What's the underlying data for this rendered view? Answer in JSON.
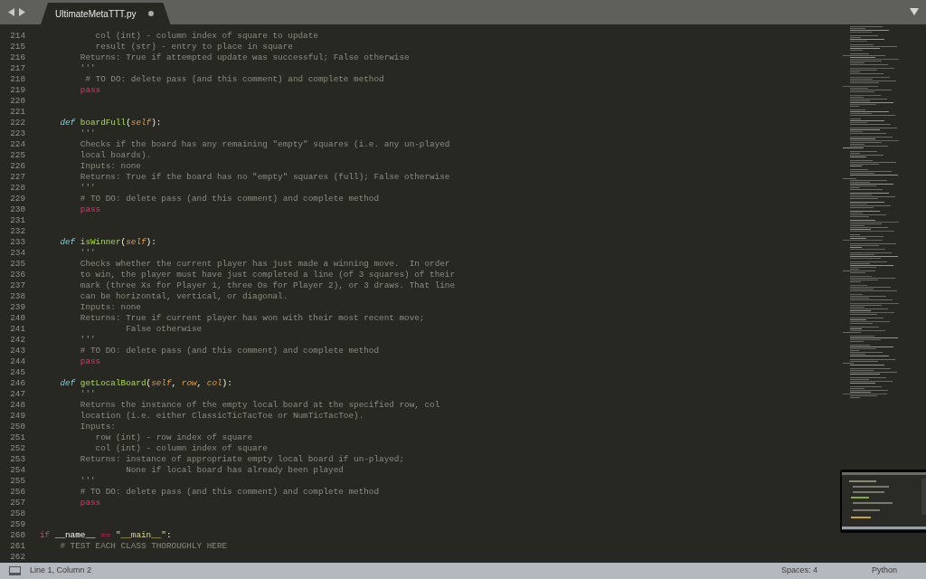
{
  "tab": {
    "title": "UltimateMetaTTT.py",
    "modified": true
  },
  "lines": [
    {
      "number": "214",
      "tokens": [
        {
          "kind": "doc",
          "text": "           col (int) - column index of square to update"
        }
      ]
    },
    {
      "number": "215",
      "tokens": [
        {
          "kind": "doc",
          "text": "           result (str) - entry to place in square"
        }
      ]
    },
    {
      "number": "216",
      "tokens": [
        {
          "kind": "doc",
          "text": "        Returns: True if attempted update was successful; False otherwise"
        }
      ]
    },
    {
      "number": "217",
      "tokens": [
        {
          "kind": "doc",
          "text": "        '''"
        }
      ]
    },
    {
      "number": "218",
      "tokens": [
        {
          "kind": "comment",
          "text": "         # TO DO: delete pass (and this comment) and complete method"
        }
      ]
    },
    {
      "number": "219",
      "tokens": [
        {
          "kind": "keyword",
          "text": "        pass"
        }
      ]
    },
    {
      "number": "220"
    },
    {
      "number": "221"
    },
    {
      "number": "222",
      "tokens": [
        {
          "kind": "storage",
          "text": "    def"
        },
        {
          "kind": "function",
          "text": " boardFull"
        },
        {
          "kind": "plain",
          "text": "("
        },
        {
          "kind": "param",
          "text": "self"
        },
        {
          "kind": "plain",
          "text": "):"
        }
      ]
    },
    {
      "number": "223",
      "tokens": [
        {
          "kind": "doc",
          "text": "        '''"
        }
      ]
    },
    {
      "number": "224",
      "tokens": [
        {
          "kind": "doc",
          "text": "        Checks if the board has any remaining \"empty\" squares (i.e. any un-played"
        }
      ]
    },
    {
      "number": "225",
      "tokens": [
        {
          "kind": "doc",
          "text": "        local boards)."
        }
      ]
    },
    {
      "number": "226",
      "tokens": [
        {
          "kind": "doc",
          "text": "        Inputs: none"
        }
      ]
    },
    {
      "number": "227",
      "tokens": [
        {
          "kind": "doc",
          "text": "        Returns: True if the board has no \"empty\" squares (full); False otherwise"
        }
      ]
    },
    {
      "number": "228",
      "tokens": [
        {
          "kind": "doc",
          "text": "        '''"
        }
      ]
    },
    {
      "number": "229",
      "tokens": [
        {
          "kind": "comment",
          "text": "        # TO DO: delete pass (and this comment) and complete method"
        }
      ]
    },
    {
      "number": "230",
      "tokens": [
        {
          "kind": "keyword",
          "text": "        pass"
        }
      ]
    },
    {
      "number": "231"
    },
    {
      "number": "232"
    },
    {
      "number": "233",
      "tokens": [
        {
          "kind": "storage",
          "text": "    def"
        },
        {
          "kind": "function",
          "text": " isWinner"
        },
        {
          "kind": "plain",
          "text": "("
        },
        {
          "kind": "param",
          "text": "self"
        },
        {
          "kind": "plain",
          "text": "):"
        }
      ]
    },
    {
      "number": "234",
      "tokens": [
        {
          "kind": "doc",
          "text": "        '''"
        }
      ]
    },
    {
      "number": "235",
      "tokens": [
        {
          "kind": "doc",
          "text": "        Checks whether the current player has just made a winning move.  In order"
        }
      ]
    },
    {
      "number": "236",
      "tokens": [
        {
          "kind": "doc",
          "text": "        to win, the player must have just completed a line (of 3 squares) of their"
        }
      ]
    },
    {
      "number": "237",
      "tokens": [
        {
          "kind": "doc",
          "text": "        mark (three Xs for Player 1, three Os for Player 2), or 3 draws. That line"
        }
      ]
    },
    {
      "number": "238",
      "tokens": [
        {
          "kind": "doc",
          "text": "        can be horizontal, vertical, or diagonal."
        }
      ]
    },
    {
      "number": "239",
      "tokens": [
        {
          "kind": "doc",
          "text": "        Inputs: none"
        }
      ]
    },
    {
      "number": "240",
      "tokens": [
        {
          "kind": "doc",
          "text": "        Returns: True if current player has won with their most recent move;"
        }
      ]
    },
    {
      "number": "241",
      "tokens": [
        {
          "kind": "doc",
          "text": "                 False otherwise"
        }
      ]
    },
    {
      "number": "242",
      "tokens": [
        {
          "kind": "doc",
          "text": "        '''"
        }
      ]
    },
    {
      "number": "243",
      "tokens": [
        {
          "kind": "comment",
          "text": "        # TO DO: delete pass (and this comment) and complete method"
        }
      ]
    },
    {
      "number": "244",
      "tokens": [
        {
          "kind": "keyword",
          "text": "        pass"
        }
      ]
    },
    {
      "number": "245"
    },
    {
      "number": "246",
      "tokens": [
        {
          "kind": "storage",
          "text": "    def"
        },
        {
          "kind": "function",
          "text": " getLocalBoard"
        },
        {
          "kind": "plain",
          "text": "("
        },
        {
          "kind": "param",
          "text": "self"
        },
        {
          "kind": "plain",
          "text": ", "
        },
        {
          "kind": "param",
          "text": "row"
        },
        {
          "kind": "plain",
          "text": ", "
        },
        {
          "kind": "param",
          "text": "col"
        },
        {
          "kind": "plain",
          "text": "):"
        }
      ]
    },
    {
      "number": "247",
      "tokens": [
        {
          "kind": "doc",
          "text": "        '''"
        }
      ]
    },
    {
      "number": "248",
      "tokens": [
        {
          "kind": "doc",
          "text": "        Returns the instance of the empty local board at the specified row, col"
        }
      ]
    },
    {
      "number": "249",
      "tokens": [
        {
          "kind": "doc",
          "text": "        location (i.e. either ClassicTicTacToe or NumTicTacToe)."
        }
      ]
    },
    {
      "number": "250",
      "tokens": [
        {
          "kind": "doc",
          "text": "        Inputs:"
        }
      ]
    },
    {
      "number": "251",
      "tokens": [
        {
          "kind": "doc",
          "text": "           row (int) - row index of square"
        }
      ]
    },
    {
      "number": "252",
      "tokens": [
        {
          "kind": "doc",
          "text": "           col (int) - column index of square"
        }
      ]
    },
    {
      "number": "253",
      "tokens": [
        {
          "kind": "doc",
          "text": "        Returns: instance of appropriate empty local board if un-played;"
        }
      ]
    },
    {
      "number": "254",
      "tokens": [
        {
          "kind": "doc",
          "text": "                 None if local board has already been played"
        }
      ]
    },
    {
      "number": "255",
      "tokens": [
        {
          "kind": "doc",
          "text": "        '''"
        }
      ]
    },
    {
      "number": "256",
      "tokens": [
        {
          "kind": "comment",
          "text": "        # TO DO: delete pass (and this comment) and complete method"
        }
      ]
    },
    {
      "number": "257",
      "tokens": [
        {
          "kind": "keyword",
          "text": "        pass"
        }
      ]
    },
    {
      "number": "258"
    },
    {
      "number": "259"
    },
    {
      "number": "260",
      "tokens": [
        {
          "kind": "keyword",
          "text": "if"
        },
        {
          "kind": "plain",
          "text": " __name__ "
        },
        {
          "kind": "keyword",
          "text": "=="
        },
        {
          "kind": "string",
          "text": " \"__main__\""
        },
        {
          "kind": "plain",
          "text": ":"
        }
      ]
    },
    {
      "number": "261",
      "tokens": [
        {
          "kind": "comment",
          "text": "    # TEST EACH CLASS THOROUGHLY HERE"
        }
      ]
    },
    {
      "number": "262"
    }
  ],
  "status_bar": {
    "position": "Line 1, Column 2",
    "indentation": "Spaces: 4",
    "syntax": "Python"
  }
}
